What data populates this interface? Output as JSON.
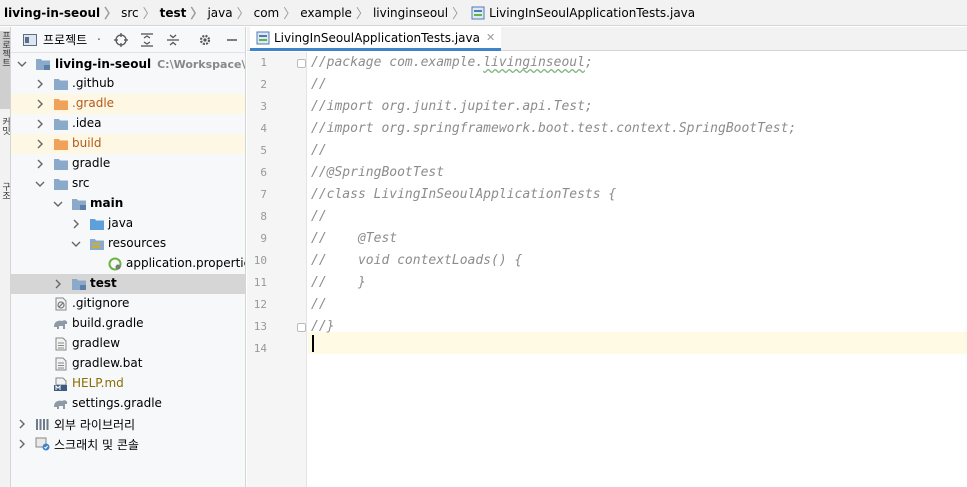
{
  "breadcrumb": {
    "items": [
      "living-in-seoul",
      "src",
      "test",
      "java",
      "com",
      "example",
      "livinginseoul",
      "LivingInSeoulApplicationTests.java"
    ]
  },
  "tool_strip": {
    "items": [
      "프로젝트",
      "커밋",
      "구조"
    ]
  },
  "project_panel": {
    "title": "프로젝트",
    "icons": [
      "locate-icon",
      "expand-all-icon",
      "collapse-all-icon",
      "gear-icon",
      "minimize-icon"
    ]
  },
  "tree": {
    "root": {
      "label": "living-in-seoul",
      "path": "C:\\Workspace\\프로"
    },
    "github": ".github",
    "gradle_hidden": ".gradle",
    "idea": ".idea",
    "build": "build",
    "gradle": "gradle",
    "src": "src",
    "main": "main",
    "java": "java",
    "resources": "resources",
    "app_props": "application.properties",
    "test": "test",
    "gitignore": ".gitignore",
    "build_gradle": "build.gradle",
    "gradlew": "gradlew",
    "gradlew_bat": "gradlew.bat",
    "help": "HELP.md",
    "settings": "settings.gradle",
    "ext_libs": "외부 라이브러리",
    "scratches": "스크래치 및 콘솔"
  },
  "editor": {
    "tab_label": "LivingInSeoulApplicationTests.java",
    "line_numbers": [
      "1",
      "2",
      "3",
      "4",
      "5",
      "6",
      "7",
      "8",
      "9",
      "10",
      "11",
      "12",
      "13",
      "14"
    ],
    "lines": {
      "l1_a": "//package com.example.",
      "l1_b": "livinginseoul",
      "l1_c": ";",
      "l2": "//",
      "l3": "//import org.junit.jupiter.api.Test;",
      "l4": "//import org.springframework.boot.test.context.SpringBootTest;",
      "l5": "//",
      "l6": "//@SpringBootTest",
      "l7": "//class LivingInSeoulApplicationTests {",
      "l8": "//",
      "l9": "//    @Test",
      "l10": "//    void contextLoads() {",
      "l11": "//    }",
      "l12": "//",
      "l13": "//}",
      "l14": ""
    }
  },
  "colors": {
    "accent": "#4083c9",
    "folder": "#8ba9c9",
    "excluded_folder": "#f0a15a",
    "comment": "#8c8c8c"
  }
}
